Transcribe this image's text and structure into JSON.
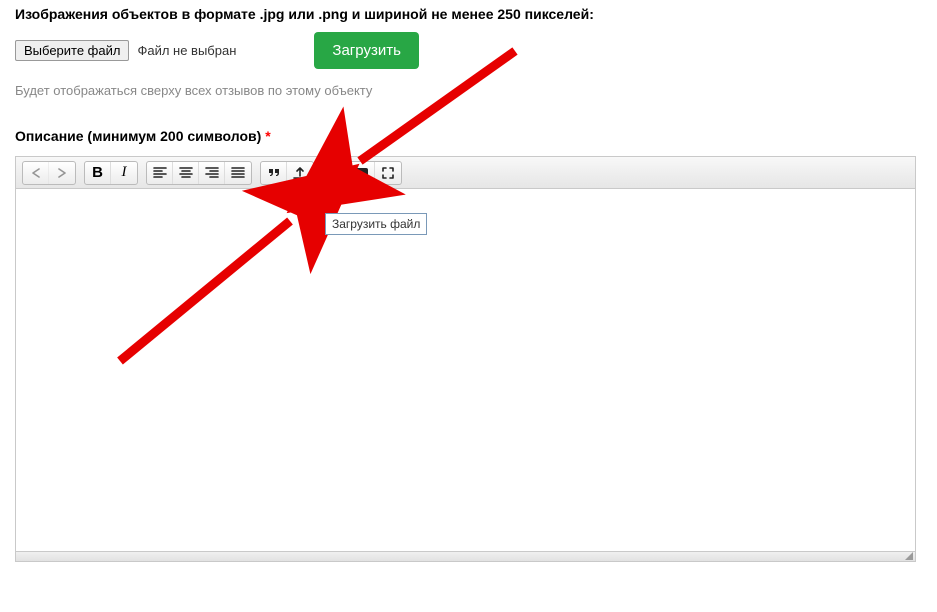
{
  "image_upload": {
    "label": "Изображения объектов в формате .jpg или .png и шириной не менее 250 пикселей:",
    "choose_file_label": "Выберите файл",
    "file_status": "Файл не выбран",
    "upload_button": "Загрузить",
    "hint": "Будет отображаться сверху всех отзывов по этому объекту"
  },
  "description": {
    "label": "Описание (минимум 200 символов)",
    "required_mark": "*"
  },
  "toolbar": {
    "undo": "↶",
    "redo": "↷",
    "bold": "B",
    "italic": "I",
    "quote": "❞",
    "upload_file_tooltip": "Загрузить файл"
  },
  "colors": {
    "accent_green": "#28a745",
    "arrow_red": "#e60000",
    "border_gray": "#c9c9c9"
  }
}
